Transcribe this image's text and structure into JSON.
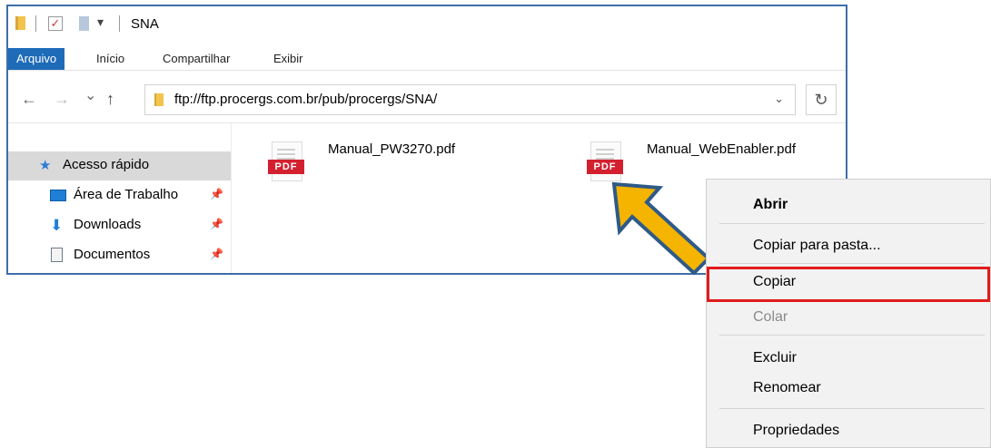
{
  "window": {
    "title": "SNA",
    "quick_access_dropdown": "▾"
  },
  "ribbon": {
    "tabs": [
      {
        "label": "Arquivo"
      },
      {
        "label": "Início"
      },
      {
        "label": "Compartilhar"
      },
      {
        "label": "Exibir"
      }
    ]
  },
  "address_bar": {
    "back": "←",
    "forward": "→",
    "recent": "⌄",
    "up": "↑",
    "path": "ftp://ftp.procergs.com.br/pub/procergs/SNA/",
    "dropdown": "⌄",
    "refresh": "↻"
  },
  "sidebar": {
    "items": [
      {
        "label": "Acesso rápido",
        "icon": "star-icon"
      },
      {
        "label": "Área de Trabalho",
        "icon": "desktop-icon"
      },
      {
        "label": "Downloads",
        "icon": "download-icon"
      },
      {
        "label": "Documentos",
        "icon": "documents-icon"
      }
    ],
    "pin_glyph": "📌"
  },
  "files": [
    {
      "name": "Manual_PW3270.pdf",
      "tag": "PDF"
    },
    {
      "name": "Manual_WebEnabler.pdf",
      "tag": "PDF"
    }
  ],
  "context_menu": {
    "items": [
      {
        "label": "Abrir"
      },
      {
        "label": "Copiar para pasta..."
      },
      {
        "label": "Copiar"
      },
      {
        "label": "Colar"
      },
      {
        "label": "Excluir"
      },
      {
        "label": "Renomear"
      },
      {
        "label": "Propriedades"
      }
    ]
  },
  "colors": {
    "accent_tab": "#1e6bb8",
    "window_border": "#3d6ea8",
    "highlight_border": "#e01b1b",
    "arrow_fill": "#f5b400",
    "arrow_stroke": "#2e5a87",
    "pdf_red": "#d3202f"
  }
}
